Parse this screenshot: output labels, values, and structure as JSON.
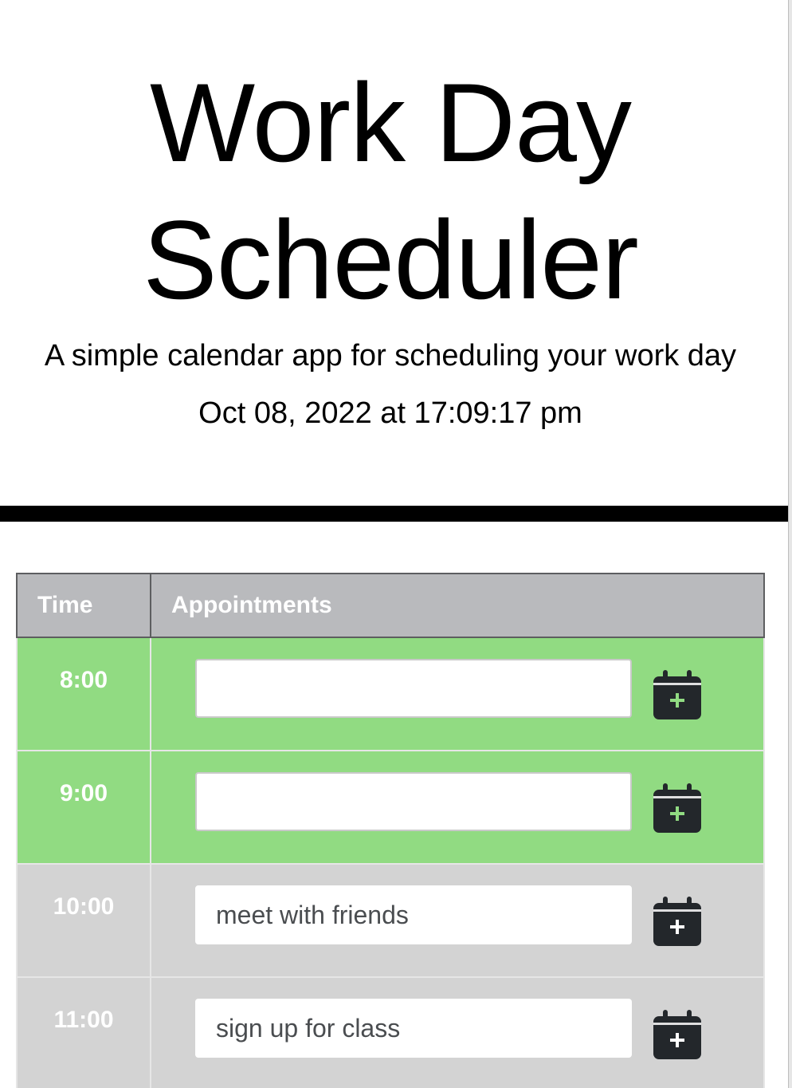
{
  "header": {
    "title": "Work Day Scheduler",
    "subtitle": "A simple calendar app for scheduling your work day",
    "datetime": "Oct 08, 2022 at 17:09:17 pm"
  },
  "table": {
    "headers": [
      "Time",
      "Appointments"
    ],
    "rows": [
      {
        "time": "8:00",
        "appointment": "",
        "status": "present"
      },
      {
        "time": "9:00",
        "appointment": "",
        "status": "present"
      },
      {
        "time": "10:00",
        "appointment": "meet with friends",
        "status": "past"
      },
      {
        "time": "11:00",
        "appointment": "sign up for class",
        "status": "past"
      }
    ]
  },
  "icons": {
    "save": "calendar-plus-icon"
  },
  "colors": {
    "present": "#91db82",
    "past": "#d3d3d3",
    "header": "#b9babd",
    "icon": "#23272b",
    "icon_plus": "#91db82"
  }
}
